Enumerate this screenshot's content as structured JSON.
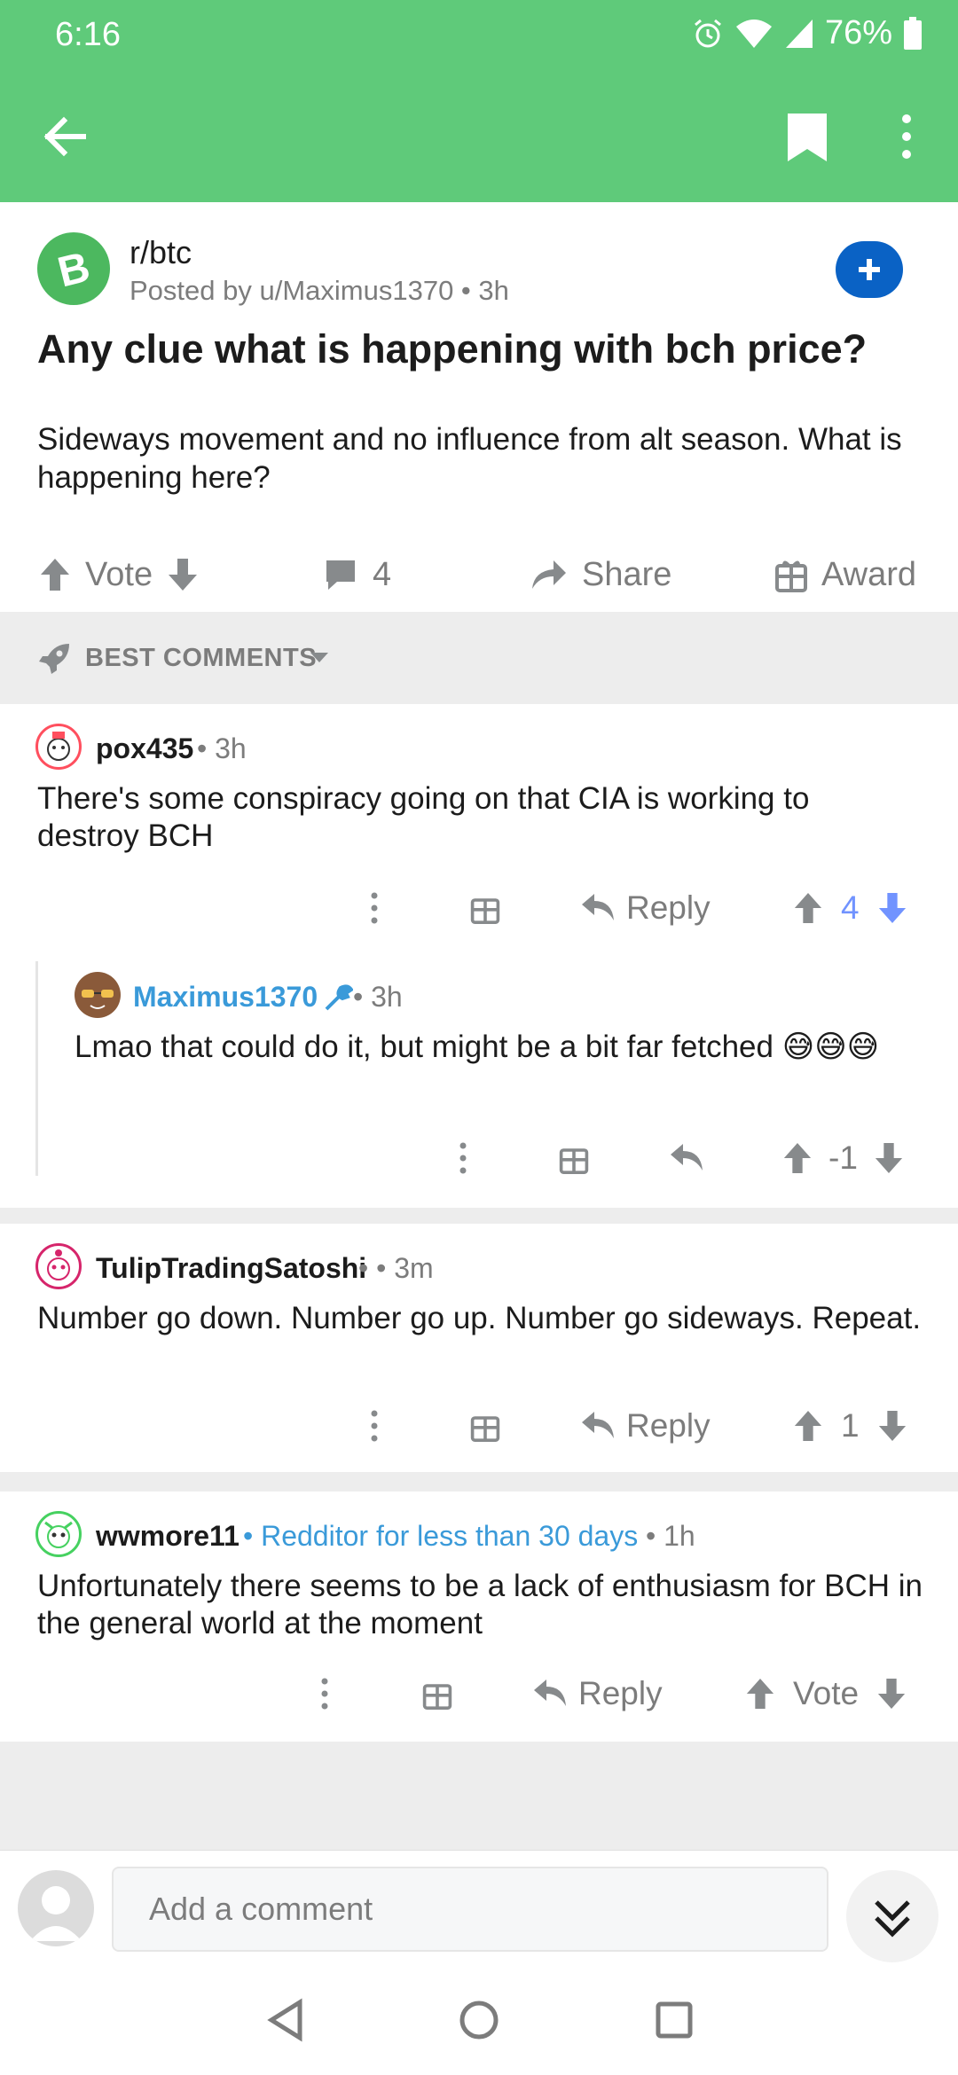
{
  "status_bar": {
    "time": "6:16",
    "battery": "76%"
  },
  "post": {
    "subreddit": "r/btc",
    "posted_by": "Posted by u/Maximus1370 • 3h",
    "title": "Any clue what is happening with bch price?",
    "body": "Sideways movement and no influence from alt season. What is happening here?",
    "actions": {
      "vote": "Vote",
      "comments": "4",
      "share": "Share",
      "award": "Award"
    }
  },
  "sort": {
    "label": "BEST COMMENTS"
  },
  "comments": [
    {
      "author": "pox435",
      "meta": "• 3h",
      "text": "There's some conspiracy going on that CIA is working to destroy BCH",
      "reply": "Reply",
      "score": "4"
    },
    {
      "author": "Maximus1370",
      "meta": "• 3h",
      "text": "Lmao that could do it, but might be a bit far fetched 😅😅😅",
      "score": "-1"
    },
    {
      "author": "TulipTradingSatoshi",
      "meta": "•  • 3m",
      "text": "Number go down. Number go up. Number go sideways. Repeat.",
      "reply": "Reply",
      "score": "1"
    },
    {
      "author": "wwmore11",
      "flair": "• Redditor for less than 30 days",
      "meta": "• 1h",
      "text": "Unfortunately there seems to be a lack of enthusiasm for BCH in the general world at the moment",
      "reply": "Reply",
      "vote": "Vote"
    }
  ],
  "composer": {
    "placeholder": "Add a comment"
  },
  "colors": {
    "header": "#5fca7a",
    "upvote_active": "#7193ff",
    "op_blue": "#3a9ad9",
    "join": "#0a62c5"
  }
}
